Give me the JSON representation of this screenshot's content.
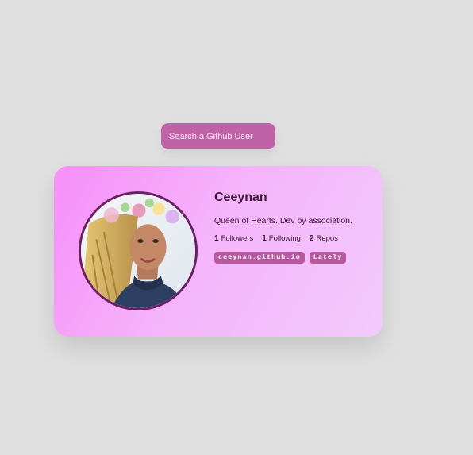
{
  "search": {
    "placeholder": "Search a Github User",
    "value": ""
  },
  "profile": {
    "name": "Ceeynan",
    "bio": "Queen of Hearts. Dev by association.",
    "stats": {
      "followers_count": "1",
      "followers_label": "Followers",
      "following_count": "1",
      "following_label": "Following",
      "repos_count": "2",
      "repos_label": "Repos"
    },
    "links": [
      {
        "label": "ceeynan.github.io"
      },
      {
        "label": "Lately"
      }
    ]
  },
  "colors": {
    "background": "#e0e0e0",
    "search_bg": "#c063a6",
    "card_gradient_start": "#f78ef9",
    "card_gradient_end": "#f1cbfb",
    "text_dark": "#3d1838",
    "pill_bg": "#b8589e",
    "avatar_border": "#6a1f62"
  }
}
